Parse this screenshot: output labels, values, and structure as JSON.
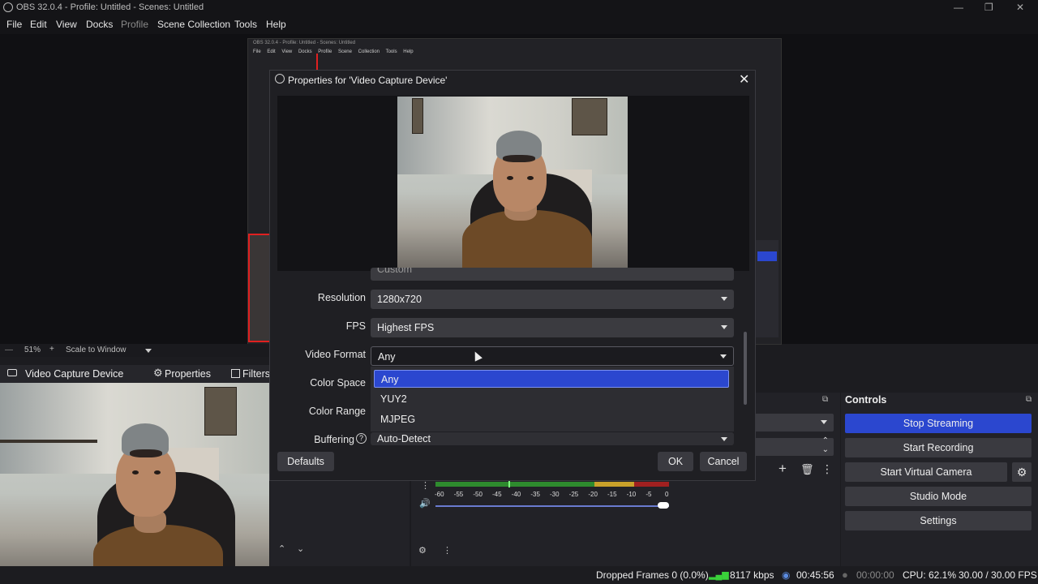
{
  "window": {
    "title": "OBS 32.0.4 - Profile: Untitled - Scenes: Untitled",
    "controls": [
      "—",
      "❐",
      "✕"
    ]
  },
  "menu": [
    "File",
    "Edit",
    "View",
    "Docks",
    "Profile",
    "Scene Collection",
    "Tools",
    "Help"
  ],
  "preview": {
    "zoom": "51%",
    "zoom_plus": "+",
    "scale_mode": "Scale to Window"
  },
  "source_toolbar": {
    "source_name": "Video Capture Device",
    "properties_label": "Properties",
    "filters_label": "Filters"
  },
  "dialog": {
    "title": "Properties for 'Video Capture Device'",
    "close": "✕",
    "fields": {
      "resolution_label": "Resolution",
      "resolution_value": "1280x720",
      "fps_label": "FPS",
      "fps_value": "Highest FPS",
      "video_format_label": "Video Format",
      "video_format_value": "Any",
      "color_space_label": "Color Space",
      "color_range_label": "Color Range",
      "buffering_label": "Buffering",
      "buffering_value": "Auto-Detect",
      "partial_value": "Custom"
    },
    "dropdown_options": [
      "Any",
      "YUY2",
      "MJPEG"
    ],
    "selected_option": "Any",
    "defaults_label": "Defaults",
    "ok_label": "OK",
    "cancel_label": "Cancel"
  },
  "mixer": {
    "ticks": [
      "-60",
      "-55",
      "-50",
      "-45",
      "-40",
      "-35",
      "-30",
      "-25",
      "-20",
      "-15",
      "-10",
      "-5",
      "0"
    ],
    "volume_level": 1.0
  },
  "controls": {
    "header": "Controls",
    "buttons": [
      "Stop Streaming",
      "Start Recording",
      "Start Virtual Camera",
      "Studio Mode",
      "Settings"
    ]
  },
  "status": {
    "dropped_frames": "Dropped Frames 0 (0.0%)",
    "bitrate": "8117 kbps",
    "stream_time": "00:45:56",
    "record_time": "00:00:00",
    "cpu": "CPU: 62.1%",
    "fps": "30.00 / 30.00 FPS"
  },
  "colors": {
    "accent": "#2b47cf",
    "recording_red": "#e02020"
  }
}
